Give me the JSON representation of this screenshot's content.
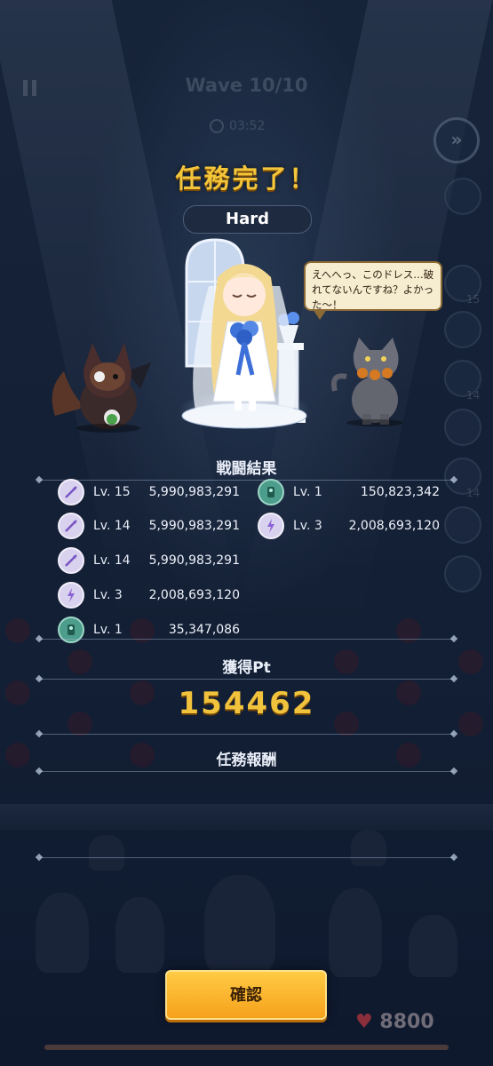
{
  "hud": {
    "wave_label": "Wave 10/10",
    "timer": "03:52",
    "side_counts": [
      "15",
      "14",
      "14"
    ]
  },
  "result_panel": {
    "title": "任務完了！",
    "difficulty": "Hard",
    "speech": "えへへっ、このドレス…破れてないんですね？よかった～！",
    "battle_header": "戦闘結果",
    "battle_results_left": [
      {
        "icon": "spear-weapon-icon",
        "level": "Lv. 15",
        "damage": "5,990,983,291"
      },
      {
        "icon": "spear-weapon-icon",
        "level": "Lv. 14",
        "damage": "5,990,983,291"
      },
      {
        "icon": "spear-weapon-icon",
        "level": "Lv. 14",
        "damage": "5,990,983,291"
      },
      {
        "icon": "lightning-weapon-icon",
        "level": "Lv. 3",
        "damage": "2,008,693,120"
      },
      {
        "icon": "green-totem-icon",
        "level": "Lv. 1",
        "damage": "35,347,086"
      }
    ],
    "battle_results_right": [
      {
        "icon": "green-totem-icon",
        "level": "Lv. 1",
        "damage": "150,823,342"
      },
      {
        "icon": "lightning-weapon-icon",
        "level": "Lv. 3",
        "damage": "2,008,693,120"
      }
    ],
    "points_header": "獲得Pt",
    "points_value": "154462",
    "reward_header": "任務報酬",
    "confirm_label": "確認"
  },
  "bottom": {
    "hp_value": "8800"
  },
  "colors": {
    "title_gold": "#f3c53a",
    "button_orange": "#f6a11b",
    "background": "#1c2a44"
  }
}
